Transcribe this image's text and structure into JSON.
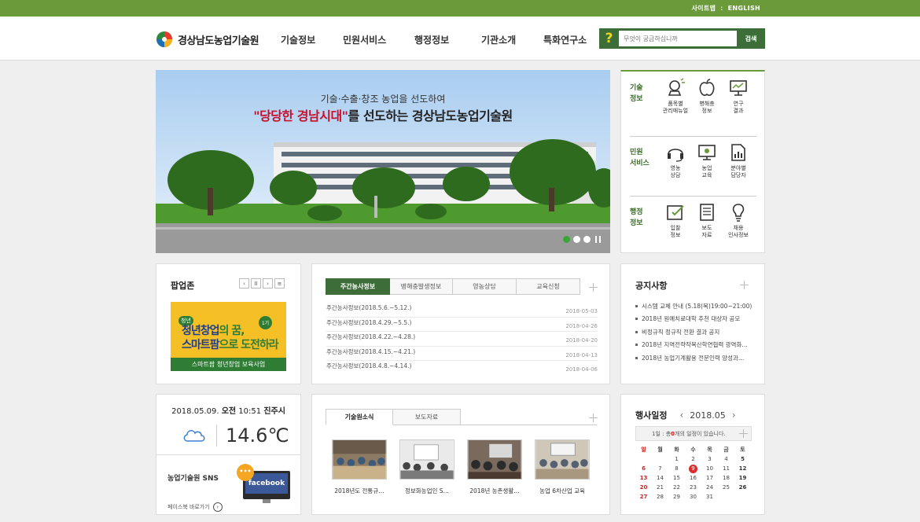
{
  "topbar": {
    "sitemap": "사이트맵",
    "separator": ":",
    "english": "ENGLISH"
  },
  "header": {
    "logo_text": "경상남도농업기술원",
    "nav": [
      "기술정보",
      "민원서비스",
      "행정정보",
      "기관소개",
      "특화연구소"
    ],
    "search_placeholder": "무엇이 궁금하십니까",
    "search_button": "검색",
    "search_help": "?"
  },
  "banner": {
    "line1": "기술·수출·창조 농업을 선도하여",
    "line2_quote": "\"당당한 경남시대\"",
    "line2_rest": "를 선도하는 경상남도농업기술원"
  },
  "quick": {
    "groups": [
      {
        "cat": [
          "기술",
          "정보"
        ],
        "items": [
          [
            "품목별",
            "관리매뉴얼"
          ],
          [
            "병해충",
            "정보"
          ],
          [
            "연구",
            "결과"
          ]
        ]
      },
      {
        "cat": [
          "민원",
          "서비스"
        ],
        "items": [
          [
            "영농",
            "상담"
          ],
          [
            "농업",
            "교육"
          ],
          [
            "분야별",
            "담당자"
          ]
        ]
      },
      {
        "cat": [
          "행정",
          "정보"
        ],
        "items": [
          [
            "입찰",
            "정보"
          ],
          [
            "보도",
            "자료"
          ],
          [
            "채용",
            "인사정보"
          ]
        ]
      }
    ]
  },
  "popup": {
    "title": "팝업존",
    "controls": [
      "‹",
      "II",
      "›",
      "≡"
    ],
    "banner_tag": "청년",
    "banner_l1a": "청년창업",
    "banner_l1b": "의 꿈,",
    "banner_l2a": "스마트팜",
    "banner_l2b": "으로 도전하라",
    "banner_badge": "1기",
    "banner_bottom": "스마트팜 청년창업 보육사업"
  },
  "news": {
    "tabs": [
      "주간농사정보",
      "병해충발생정보",
      "영농상담",
      "교육신청"
    ],
    "items": [
      {
        "title": "주간농사정보(2018.5.6.~5.12.)",
        "date": "2018-05-03"
      },
      {
        "title": "주간농사정보(2018.4.29.~5.5.)",
        "date": "2018-04-26"
      },
      {
        "title": "주간농사정보(2018.4.22.~4.28.)",
        "date": "2018-04-20"
      },
      {
        "title": "주간농사정보(2018.4.15.~4.21.)",
        "date": "2018-04-13"
      },
      {
        "title": "주간농사정보(2018.4.8.~4.14.)",
        "date": "2018-04-06"
      }
    ]
  },
  "notice": {
    "title": "공지사항",
    "items": [
      "시스템 교체 안내 (5.18(목)19:00~21:00)",
      "2018년 원예치료대학 추천 대상자 공모",
      "비정규직 정규직 전환 결과 공지",
      "2018년 지역전략작목산학연협력 광역화…",
      "2018년 농업기계활용 전문인력 양성과…"
    ]
  },
  "weather": {
    "date": "2018.05.09.",
    "ampm": "오전",
    "time": "10:51",
    "place": "진주시",
    "temp": "14.6℃"
  },
  "sns": {
    "title": "농업기술원 SNS",
    "brand": "facebook",
    "dots": "•••",
    "link": "페이스북 바로가기",
    "link_icon": "›"
  },
  "tech": {
    "tabs": [
      "기술원소식",
      "보도자료"
    ],
    "items": [
      "2018년도 전통규…",
      "정보화농업인 S…",
      "2018년 농촌생활…",
      "농업 6차산업 교육"
    ]
  },
  "calendar": {
    "title": "행사일정",
    "month": "2018.05",
    "prev": "‹",
    "next": "›",
    "info_pre": "1일 : 총 ",
    "info_count": "0",
    "info_post": "개의 일정이 있습니다.",
    "weekdays": [
      "일",
      "월",
      "화",
      "수",
      "목",
      "금",
      "토"
    ],
    "weeks": [
      [
        "",
        "",
        "1",
        "2",
        "3",
        "4",
        "5"
      ],
      [
        "6",
        "7",
        "8",
        "9",
        "10",
        "11",
        "12"
      ],
      [
        "13",
        "14",
        "15",
        "16",
        "17",
        "18",
        "19"
      ],
      [
        "20",
        "21",
        "22",
        "23",
        "24",
        "25",
        "26"
      ],
      [
        "27",
        "28",
        "29",
        "30",
        "31",
        "",
        ""
      ]
    ],
    "today": "9"
  }
}
